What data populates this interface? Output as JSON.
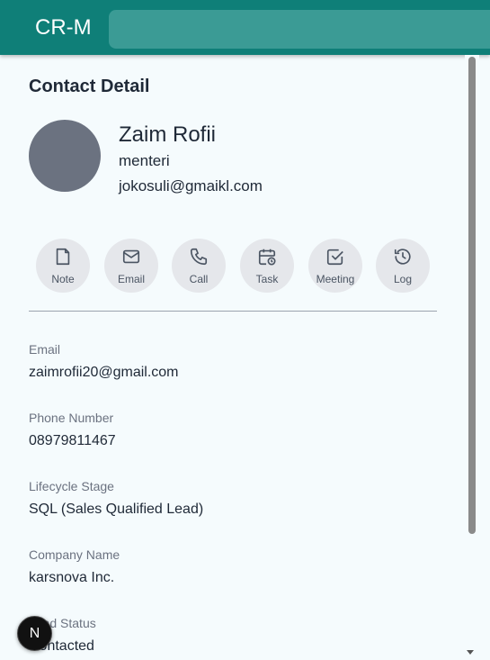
{
  "app": {
    "brand": "CR-M",
    "search_placeholder": ""
  },
  "page": {
    "title": "Contact Detail"
  },
  "contact": {
    "name": "Zaim Rofii",
    "job_title": "menteri",
    "email_header": "jokosuli@gmaikl.com"
  },
  "actions": [
    {
      "label": "Note",
      "icon": "note-icon"
    },
    {
      "label": "Email",
      "icon": "mail-icon"
    },
    {
      "label": "Call",
      "icon": "phone-icon"
    },
    {
      "label": "Task",
      "icon": "calendar-clock-icon"
    },
    {
      "label": "Meeting",
      "icon": "checkbox-icon"
    },
    {
      "label": "Log",
      "icon": "history-icon"
    }
  ],
  "fields": [
    {
      "label": "Email",
      "value": "zaimrofii20@gmail.com"
    },
    {
      "label": "Phone Number",
      "value": "08979811467"
    },
    {
      "label": "Lifecycle Stage",
      "value": "SQL (Sales Qualified Lead)"
    },
    {
      "label": "Company Name",
      "value": "karsnova Inc."
    },
    {
      "label": "Lead Status",
      "value": "Contacted"
    }
  ],
  "fab": {
    "label": "N"
  }
}
